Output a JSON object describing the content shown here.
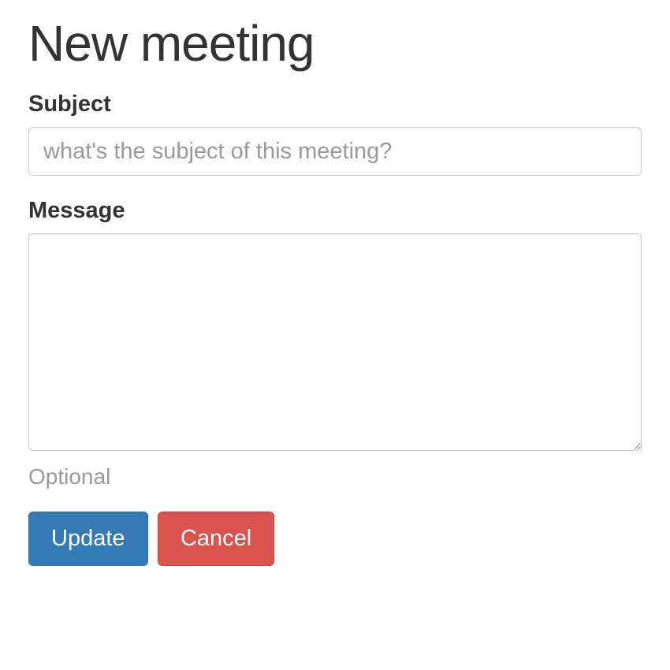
{
  "page": {
    "title": "New meeting"
  },
  "form": {
    "subject": {
      "label": "Subject",
      "placeholder": "what's the subject of this meeting?",
      "value": ""
    },
    "message": {
      "label": "Message",
      "value": "",
      "help": "Optional"
    }
  },
  "actions": {
    "submit_label": "Update",
    "cancel_label": "Cancel"
  }
}
